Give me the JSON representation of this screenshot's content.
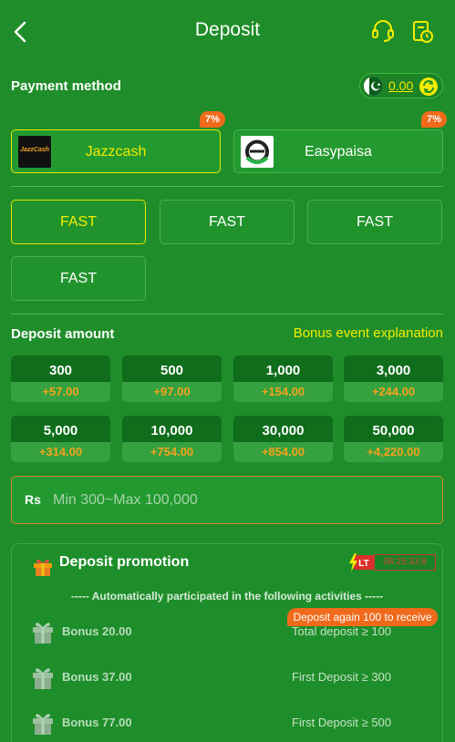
{
  "header": {
    "title": "Deposit"
  },
  "payment": {
    "label": "Payment method",
    "balance": "0.00",
    "methods": [
      {
        "name": "Jazzcash",
        "badge": "7%",
        "logo_text": "JazzCash",
        "selected": true
      },
      {
        "name": "Easypaisa",
        "badge": "7%",
        "selected": false
      }
    ]
  },
  "channels": [
    {
      "label": "FAST",
      "selected": true
    },
    {
      "label": "FAST",
      "selected": false
    },
    {
      "label": "FAST",
      "selected": false
    },
    {
      "label": "FAST",
      "selected": false
    }
  ],
  "amount": {
    "label": "Deposit amount",
    "bonus_link": "Bonus event explanation",
    "options": [
      {
        "value": "300",
        "bonus": "+57.00"
      },
      {
        "value": "500",
        "bonus": "+97.00"
      },
      {
        "value": "1,000",
        "bonus": "+154.00"
      },
      {
        "value": "3,000",
        "bonus": "+244.00"
      },
      {
        "value": "5,000",
        "bonus": "+314.00"
      },
      {
        "value": "10,000",
        "bonus": "+754.00"
      },
      {
        "value": "30,000",
        "bonus": "+854.00"
      },
      {
        "value": "50,000",
        "bonus": "+4,220.00"
      }
    ],
    "currency": "Rs",
    "placeholder": "Min 300~Max 100,000"
  },
  "promotion": {
    "title": "Deposit promotion",
    "lt_label": "LT",
    "timer": "08:25:33:8",
    "auto_text": "----- Automatically participated in the following activities -----",
    "again_badge": "Deposit again 100 to receive",
    "items": [
      {
        "bonus": "Bonus 20.00",
        "condition": "Total deposit ≥ 100"
      },
      {
        "bonus": "Bonus 37.00",
        "condition": "First Deposit ≥ 300"
      },
      {
        "bonus": "Bonus 77.00",
        "condition": "First Deposit ≥ 500"
      }
    ]
  },
  "colors": {
    "background": "#1f8e2a",
    "accent_yellow": "#f3ec00",
    "bonus_orange": "#f4a21d",
    "badge_orange": "#f06a1b"
  },
  "icons": {
    "back": "chevron-left-icon",
    "support": "headset-icon",
    "history": "clipboard-clock-icon",
    "flag": "pakistan-flag-icon",
    "refresh": "refresh-icon",
    "gift": "gift-icon",
    "lightning": "lightning-icon"
  }
}
